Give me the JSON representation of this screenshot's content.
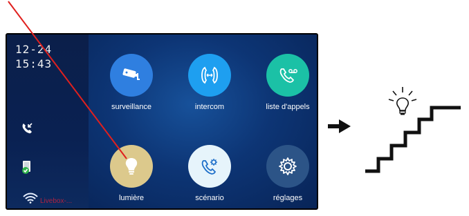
{
  "status": {
    "date": "12-24",
    "time": "15:43",
    "wifi_label": "Livebox-..."
  },
  "tiles": [
    {
      "label": "surveillance",
      "icon": "cctv-camera-icon",
      "color": "#2f7fe0"
    },
    {
      "label": "intercom",
      "icon": "intercom-call-icon",
      "color": "#1e9ff0"
    },
    {
      "label": "liste d'appels",
      "icon": "call-log-icon",
      "color": "#1bc1a6"
    },
    {
      "label": "lumière",
      "icon": "light-bulb-icon",
      "color": "#dcc98c"
    },
    {
      "label": "scénario",
      "icon": "scenario-phone-gear-icon",
      "color": "#e6f4fb"
    },
    {
      "label": "réglages",
      "icon": "gear-icon",
      "color": "#2c5487"
    }
  ],
  "colors": {
    "annotation_line": "#e0201e",
    "wifi_label": "#c0213d"
  }
}
